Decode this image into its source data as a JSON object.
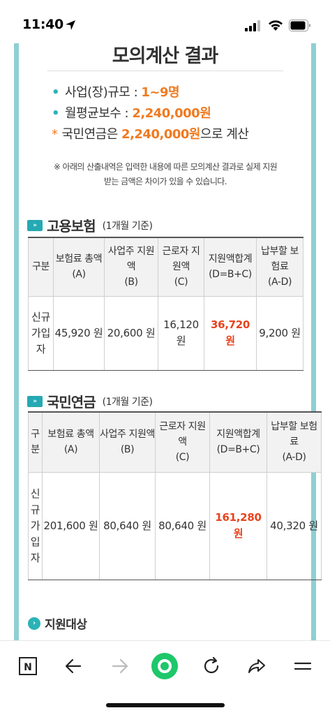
{
  "status": {
    "time": "11:40"
  },
  "title": "모의계산 결과",
  "summary": {
    "scale_label": "사업(장)규모 :",
    "scale_value": "1~9명",
    "wage_label": "월평균보수  :",
    "wage_value": "2,240,000원",
    "pension_prefix": "국민연금은",
    "pension_value": "2,240,000원",
    "pension_suffix": "으로 계산"
  },
  "notice_line1": "※ 아래의 산출내역은 입력한 내용에 따른 모의계산 결과로 실제 지원",
  "notice_line2": "받는 금액은 차이가 있을 수 있습니다.",
  "employment": {
    "badge": "»",
    "title": "고용보험",
    "note": "(1개월 기준)",
    "headers": [
      "구분",
      "보험료 총액\n(A)",
      "사업주 지원액\n(B)",
      "근로자 지원액\n(C)",
      "지원액합계\n(D=B+C)",
      "납부할 보험료\n(A-D)"
    ],
    "row": {
      "label": "신규가입자",
      "total": "45,920 원",
      "employer": "20,600 원",
      "worker": "16,120 원",
      "support": "36,720 원",
      "payable": "9,200 원"
    }
  },
  "pension": {
    "badge": "»",
    "title": "국민연금",
    "note": "(1개월 기준)",
    "headers": [
      "구분",
      "보험료 총액\n(A)",
      "사업주 지원액\n(B)",
      "근로자 지원액\n(C)",
      "지원액합계\n(D=B+C)",
      "납부할 보험료\n(A-D)"
    ],
    "row": {
      "label": "신규가입자",
      "total": "201,600 원",
      "employer": "80,640 원",
      "worker": "80,640 원",
      "support": "161,280 원",
      "payable": "40,320 원"
    }
  },
  "target": {
    "icon": "›",
    "title": "지원대상"
  },
  "toolbar": {
    "n_icon": "N"
  },
  "colors": {
    "accent": "#2bb3b8",
    "orange": "#f07a20",
    "red": "#e8431e",
    "rail": "#8fcfd2"
  },
  "icons": [
    "location-arrow-icon",
    "signal-icon",
    "wifi-icon",
    "battery-icon",
    "naver-n-icon",
    "back-arrow-icon",
    "forward-arrow-icon",
    "home-green-icon",
    "refresh-icon",
    "share-icon",
    "menu-icon"
  ]
}
